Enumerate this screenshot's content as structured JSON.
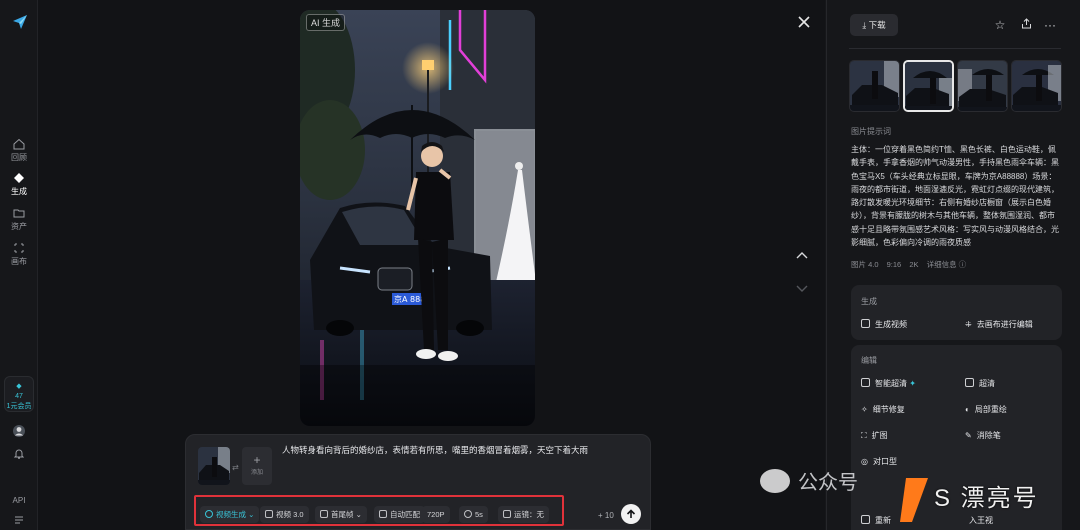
{
  "nav": {
    "items": [
      {
        "label": "回顾",
        "icon": "home-icon"
      },
      {
        "label": "生成",
        "icon": "diamond-icon"
      },
      {
        "label": "资产",
        "icon": "folder-icon"
      },
      {
        "label": "画布",
        "icon": "canvas-icon"
      }
    ],
    "credit": {
      "value": "47",
      "label": "1元会员"
    },
    "bottom": {
      "api": "API"
    }
  },
  "viewer": {
    "ai_badge": "AI 生成"
  },
  "prompt": {
    "add_label": "添加",
    "text": "人物转身看向背后的婚纱店，表情若有所思，嘴里的香烟冒着烟雾，天空下着大雨",
    "chips": {
      "mode": "视频生成",
      "model": "视频 3.0",
      "frame": "首尾帧",
      "ratio": "自动匹配",
      "resolution": "720P",
      "duration": "5s",
      "motion": "运镜：无"
    },
    "count": "+ 10"
  },
  "right": {
    "download": "下载",
    "prompt_label": "图片提示词",
    "description": "主体：一位穿着黑色简约T恤、黑色长裤、白色运动鞋，佩戴手表，手拿香烟的帅气动漫男性，手持黑色雨伞车辆：黑色宝马X5（车头经典立标显眼，车牌为京A88888）场景：雨夜的都市街道，地面湿漉反光，霓虹灯点缀的现代建筑，路灯散发暖光环境细节：右侧有婚纱店橱窗（展示白色婚纱），背景有朦胧的树木与其他车辆，整体氛围湿润、都市感十足且略带氛围感艺术风格：写实风与动漫风格结合，光影细腻，色彩偏向冷调的雨夜质感",
    "meta": [
      "图片 4.0",
      "9:16",
      "2K",
      "详细信息 ⓘ"
    ],
    "generate": {
      "title": "生成",
      "video": "生成视频",
      "canvas": "去画布进行编辑"
    },
    "edit": {
      "title": "编辑",
      "smart_hd": "智能超清",
      "hd": "超清",
      "detail_fix": "细节修复",
      "local_redraw": "局部重绘",
      "expand": "扩图",
      "eraser": "消除笔",
      "lip_sync": "对口型",
      "regen": "重新",
      "regen2": "入王视"
    }
  },
  "watermark": {
    "text": "公众号",
    "brand": "S 漂亮号"
  },
  "colors": {
    "accent": "#39c5d8",
    "highlight_box": "#e0323a",
    "background": "#16171a"
  }
}
